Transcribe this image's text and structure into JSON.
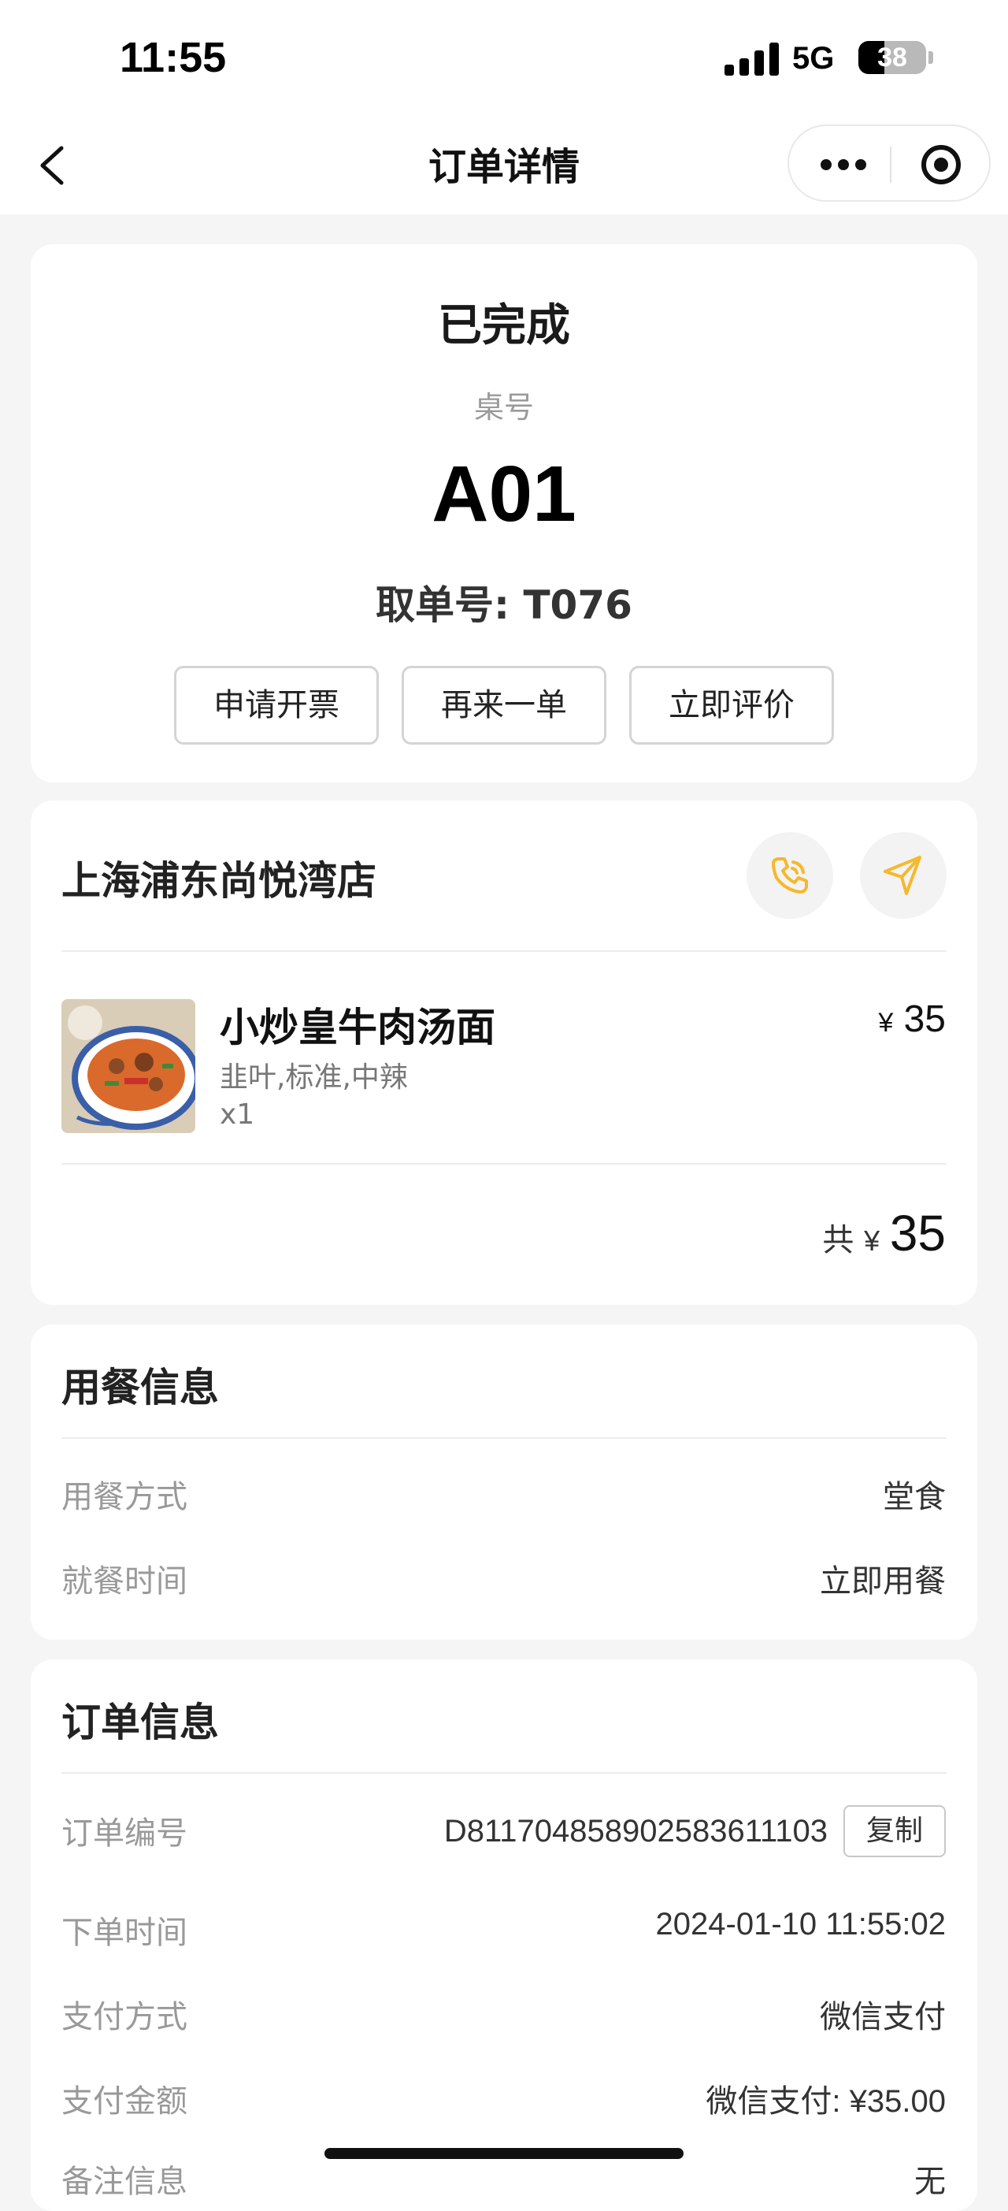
{
  "status_bar": {
    "time": "11:55",
    "network": "5G",
    "battery_percent": "38",
    "battery_level": 0.38
  },
  "nav": {
    "title": "订单详情"
  },
  "order_status": {
    "status": "已完成",
    "table_label": "桌号",
    "table_number": "A01",
    "pickup_number": "取单号: T076",
    "actions": [
      "申请开票",
      "再来一单",
      "立即评价"
    ]
  },
  "store": {
    "name": "上海浦东尚悦湾店",
    "items": [
      {
        "name": "小炒皇牛肉汤面",
        "spec": "韭叶,标准,中辣",
        "quantity": "x1",
        "currency": "¥",
        "price": "35"
      }
    ],
    "total_label": "共",
    "total_currency": "¥",
    "total_amount": "35"
  },
  "dining_info": {
    "title": "用餐信息",
    "rows": [
      {
        "label": "用餐方式",
        "value": "堂食"
      },
      {
        "label": "就餐时间",
        "value": "立即用餐"
      }
    ]
  },
  "order_info": {
    "title": "订单信息",
    "copy_label": "复制",
    "rows": [
      {
        "label": "订单编号",
        "value": "D811704858902583611103"
      },
      {
        "label": "下单时间",
        "value": "2024-01-10 11:55:02"
      },
      {
        "label": "支付方式",
        "value": "微信支付"
      },
      {
        "label": "支付金额",
        "value": "微信支付: ¥35.00"
      },
      {
        "label": "备注信息",
        "value": "无"
      }
    ]
  },
  "colors": {
    "accent_yellow": "#f5b82e",
    "background": "#f5f5f5"
  }
}
